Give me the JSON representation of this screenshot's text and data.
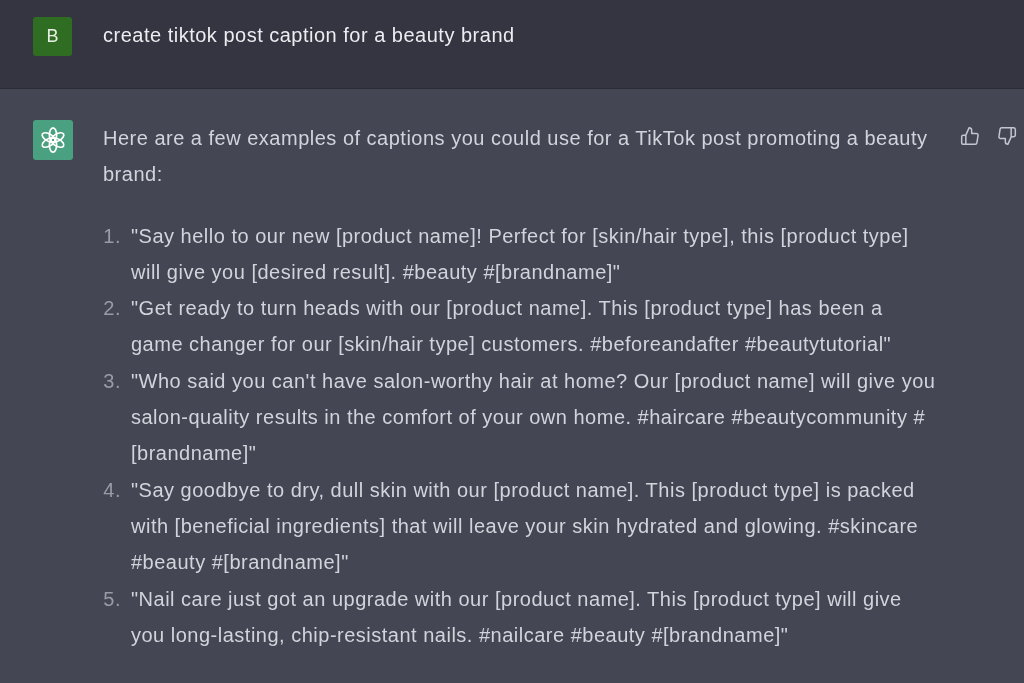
{
  "prompt": {
    "avatar_letter": "B",
    "text": "create tiktok post caption for a beauty brand"
  },
  "response": {
    "intro": "Here are a few examples of captions you could use for a TikTok post promoting a beauty brand:",
    "items": [
      {
        "number": "1.",
        "text": "\"Say hello to our new [product name]! Perfect for [skin/hair type], this [product type] will give you [desired result]. #beauty #[brandname]\""
      },
      {
        "number": "2.",
        "text": "\"Get ready to turn heads with our [product name]. This [product type] has been a game changer for our [skin/hair type] customers. #beforeandafter #beautytutorial\""
      },
      {
        "number": "3.",
        "text": "\"Who said you can't have salon-worthy hair at home? Our [product name] will give you salon-quality results in the comfort of your own home. #haircare #beautycommunity #[brandname]\""
      },
      {
        "number": "4.",
        "text": "\"Say goodbye to dry, dull skin with our [product name]. This [product type] is packed with [beneficial ingredients] that will leave your skin hydrated and glowing. #skincare #beauty #[brandname]\""
      },
      {
        "number": "5.",
        "text": "\"Nail care just got an upgrade with our [product name]. This [product type] will give you long-lasting, chip-resistant nails. #nailcare #beauty #[brandname]\""
      }
    ]
  }
}
